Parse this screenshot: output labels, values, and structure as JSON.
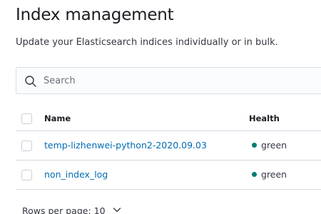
{
  "header": {
    "title": "Index management",
    "subtitle": "Update your Elasticsearch indices individually or in bulk."
  },
  "search": {
    "placeholder": "Search",
    "icon": "search-icon"
  },
  "table": {
    "columns": {
      "name": "Name",
      "health": "Health"
    },
    "rows": [
      {
        "name": "temp-lizhenwei-python2-2020.09.03",
        "health": "green"
      },
      {
        "name": "non_index_log",
        "health": "green"
      }
    ]
  },
  "pagination": {
    "rows_per_page_label": "Rows per page: 10"
  },
  "colors": {
    "health_green": "#017d73",
    "link": "#006bb4"
  }
}
